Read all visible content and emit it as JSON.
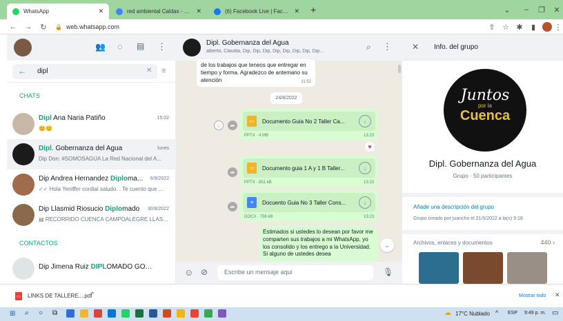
{
  "browser": {
    "tabs": [
      {
        "title": "WhatsApp",
        "favicon_color": "#25d366"
      },
      {
        "title": "red ambiental Caldas - Buscar co",
        "favicon_color": "#4285f4"
      },
      {
        "title": "(6) Facebook Live | Facebook",
        "favicon_color": "#1877f2"
      }
    ],
    "url": "web.whatsapp.com"
  },
  "left": {
    "search_value": "dipl",
    "chats_label": "CHATS",
    "contacts_label": "CONTACTOS",
    "chats": [
      {
        "hl": "Dipl",
        "name_rest": " Ana Naria Patiño",
        "time": "15:02",
        "msg": "😊😊"
      },
      {
        "hl": "Dipl",
        "name_rest": ". Gobernanza del Agua",
        "time": "lunes",
        "msg": "Dip Don: #SOMOSAGUA  La Red Nacional del A..."
      },
      {
        "name_pre": "Dip Andrea Hernandez ",
        "hl": "Diplo",
        "name_rest": "ma...",
        "time": "6/9/2022",
        "msg": "✓✓ Hola Yeniffer cordial saludo. . Te cuento que ..."
      },
      {
        "name_pre": "Dip Llasmid Riosucio  ",
        "hl": "Diplo",
        "name_rest": "mado",
        "time": "30/8/2022",
        "msg": "▤ RECORRIDO CUENCA CAMPOALEGRE LLASM..."
      }
    ],
    "contact": {
      "name_pre": "Dip Jimena Ruiz ",
      "hl": "DIPL",
      "name_rest": "OMADO GOBERN..."
    }
  },
  "middle": {
    "group_name": "Dipl. Gobernanza del Agua",
    "members": "alberto, Claudia, Dip, Dip, Dip, Dip, Dip, Dip, Dip, Dip...",
    "first_msg": "de los trabajos que teneos que entregar en tiempo y forma. Agradezco de antemano su atención",
    "first_time": "11:52",
    "date_chip": "24/8/2022",
    "docs": [
      {
        "title": "Documento Guia No 2 Taller Ca...",
        "meta": "PPTX · 4 MB",
        "time": "13:23",
        "type": "pptx"
      },
      {
        "title": "Documento guia 1 A y 1 B Taller...",
        "meta": "PPTX · 851 kB",
        "time": "13:23",
        "type": "pptx"
      },
      {
        "title": "Docuento Guia No 3 Taller Cons...",
        "meta": "DOCX · 756 kB",
        "time": "13:23",
        "type": "docx"
      }
    ],
    "last_msg": "Estimados si ustedes lo desean  por favor me comparten sus trabajos a mi WhatsApp, yo los consolido y los entrego a la Universidad. Si alguno de ustedes desea",
    "composer_placeholder": "Escribe un mensaje aquí"
  },
  "right": {
    "title": "Info. del grupo",
    "logo_line1": "Juntos",
    "logo_line2": "por la",
    "logo_line3": "Cuenca",
    "group_name": "Dipl. Gobernanza del Agua",
    "participants": "Grupo · 50 participantes",
    "add_description": "Añade una descripción del grupo",
    "created": "Grupo creado por juancho el 21/5/2022 a la(s) 9:18",
    "media_label": "Archivos, enlaces y documentos",
    "media_count": "440 ›"
  },
  "downloads": {
    "file": "LINKS DE TALLERE....pdf",
    "show_all": "Mostrar todo"
  },
  "taskbar": {
    "weather": "17°C  Nublado",
    "lang": "ESP",
    "time": "9:49 p. m."
  }
}
